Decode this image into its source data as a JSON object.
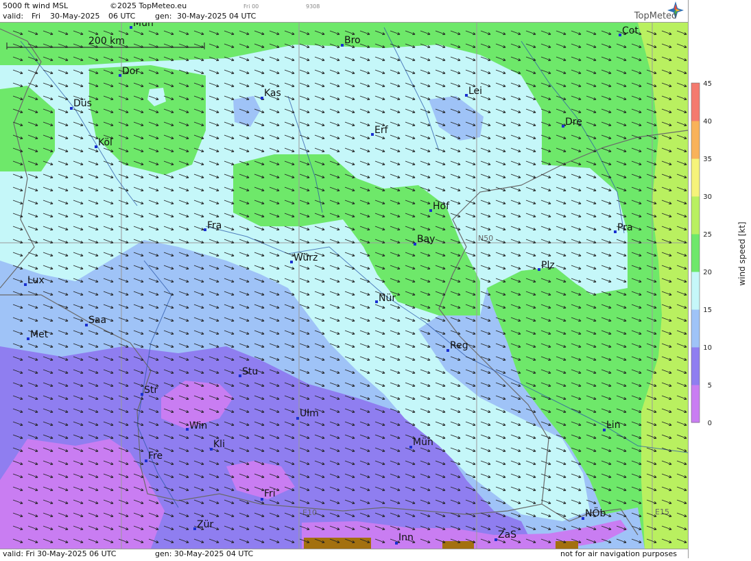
{
  "header": {
    "product": "5000 ft wind MSL",
    "copyright": "©2025 TopMeteo.eu",
    "valid_label": "valid:",
    "valid_day": "Fri",
    "valid_date": "30-May-2025",
    "valid_time": "06 UTC",
    "gen_label": "gen:",
    "gen_value": "30-May-2025 04 UTC",
    "run_small": "Fri 00",
    "code_small": "9308",
    "brand": "TopMeteo"
  },
  "footer": {
    "valid_text": "valid:  Fri  30-May-2025  06 UTC",
    "gen_text": "gen:  30-May-2025 04 UTC",
    "disclaimer": "not for air navigation purposes"
  },
  "scale_bar": {
    "label": "200 km"
  },
  "grid_labels": {
    "n50": "N50",
    "e10": "E10",
    "e15": "E15"
  },
  "legend": {
    "title": "wind speed [kt]",
    "ticks": [
      "0",
      "5",
      "10",
      "15",
      "20",
      "25",
      "30",
      "35",
      "40",
      "45"
    ],
    "colors": {
      "0-5": "#c97df2",
      "5-10": "#8f7ef0",
      "10-15": "#9fc3f7",
      "15-20": "#c5f7f9",
      "20-25": "#6ee86a",
      "25-30": "#b9f060",
      "30-35": "#f6f37a",
      "35-40": "#f9b25a",
      "40-45": "#f47a6e"
    }
  },
  "cities": [
    {
      "name": "Mün"
    },
    {
      "name": "Bro"
    },
    {
      "name": "Cot"
    },
    {
      "name": "Dor"
    },
    {
      "name": "Kas"
    },
    {
      "name": "Lei"
    },
    {
      "name": "Düs"
    },
    {
      "name": "Erf"
    },
    {
      "name": "Dre"
    },
    {
      "name": "Köl"
    },
    {
      "name": "Hof"
    },
    {
      "name": "Fra"
    },
    {
      "name": "Pra"
    },
    {
      "name": "Bay"
    },
    {
      "name": "Würz"
    },
    {
      "name": "Plz"
    },
    {
      "name": "Lux"
    },
    {
      "name": "Nür"
    },
    {
      "name": "Saa"
    },
    {
      "name": "Met"
    },
    {
      "name": "Reg"
    },
    {
      "name": "Stu"
    },
    {
      "name": "Str"
    },
    {
      "name": "Ulm"
    },
    {
      "name": "Lin"
    },
    {
      "name": "Win"
    },
    {
      "name": "Kli"
    },
    {
      "name": "Mün"
    },
    {
      "name": "Fre"
    },
    {
      "name": "Fri"
    },
    {
      "name": "NÖb"
    },
    {
      "name": "Zür"
    },
    {
      "name": "ZaS"
    },
    {
      "name": "Inn"
    }
  ]
}
